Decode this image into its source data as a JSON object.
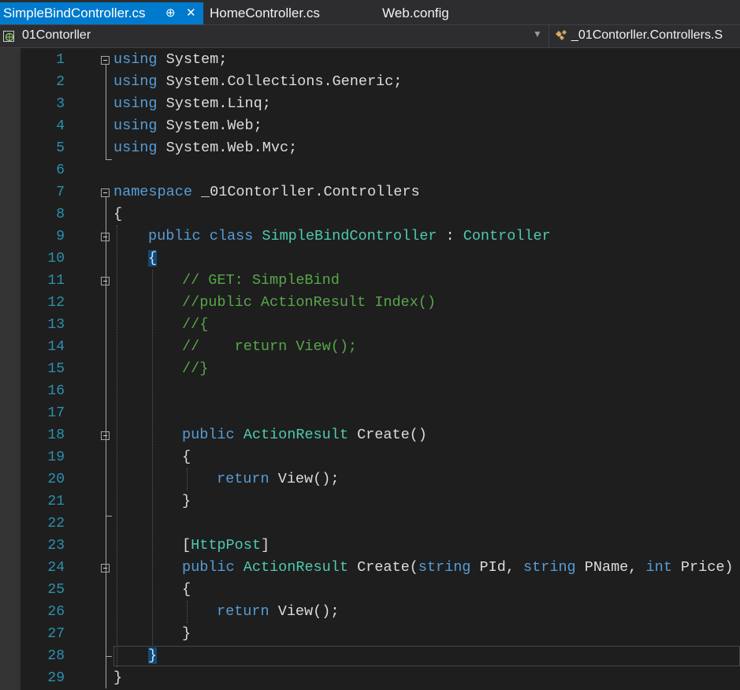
{
  "tabs": [
    {
      "label": "SimpleBindController.cs",
      "active": true,
      "pin_icon": "pin-icon",
      "close_icon": "close-icon",
      "pin_glyph": "⊕",
      "close_glyph": "✕"
    },
    {
      "label": "HomeController.cs",
      "active": false
    },
    {
      "label": "Web.config",
      "active": false
    }
  ],
  "navbar": {
    "project": "01Contorller",
    "project_icon": "project-globe-icon",
    "class_path": "_01Contorller.Controllers.S",
    "class_icon": "class-icon",
    "dropdown_glyph": "▼"
  },
  "colors": {
    "keyword": "#569cd6",
    "type": "#4ec9b0",
    "comment": "#57a64a",
    "line_number": "#2b91af",
    "text": "#dcdcdc",
    "background": "#1e1e1e",
    "active_tab": "#007acc"
  },
  "editor": {
    "line_numbers": [
      "1",
      "2",
      "3",
      "4",
      "5",
      "6",
      "7",
      "8",
      "9",
      "10",
      "11",
      "12",
      "13",
      "14",
      "15",
      "16",
      "17",
      "18",
      "19",
      "20",
      "21",
      "22",
      "23",
      "24",
      "25",
      "26",
      "27",
      "28",
      "29"
    ],
    "code": {
      "l1_kw": "using",
      "l1_rest": " System;",
      "l2_kw": "using",
      "l2_rest": " System.Collections.Generic;",
      "l3_kw": "using",
      "l3_rest": " System.Linq;",
      "l4_kw": "using",
      "l4_rest": " System.Web;",
      "l5_kw": "using",
      "l5_rest": " System.Web.Mvc;",
      "l7_kw": "namespace",
      "l7_rest": " _01Contorller.Controllers",
      "l8": "{",
      "l9_kw1": "public",
      "l9_kw2": "class",
      "l9_type1": "SimpleBindController",
      "l9_sep": " : ",
      "l9_type2": "Controller",
      "l10": "{",
      "l11": "// GET: SimpleBind",
      "l12": "//public ActionResult Index()",
      "l13": "//{",
      "l14": "//    return View();",
      "l15": "//}",
      "l18_kw": "public",
      "l18_type": "ActionResult",
      "l18_rest": " Create()",
      "l19": "{",
      "l20_kw": "return",
      "l20_rest": " View();",
      "l21": "}",
      "l23_open": "[",
      "l23_type": "HttpPost",
      "l23_close": "]",
      "l24_kw": "public",
      "l24_type": "ActionResult",
      "l24_a": " Create(",
      "l24_k1": "string",
      "l24_b": " PId, ",
      "l24_k2": "string",
      "l24_c": " PName, ",
      "l24_k3": "int",
      "l24_d": " Price)",
      "l25": "{",
      "l26_kw": "return",
      "l26_rest": " View();",
      "l27": "}",
      "l28": "}",
      "l29": "}"
    }
  }
}
